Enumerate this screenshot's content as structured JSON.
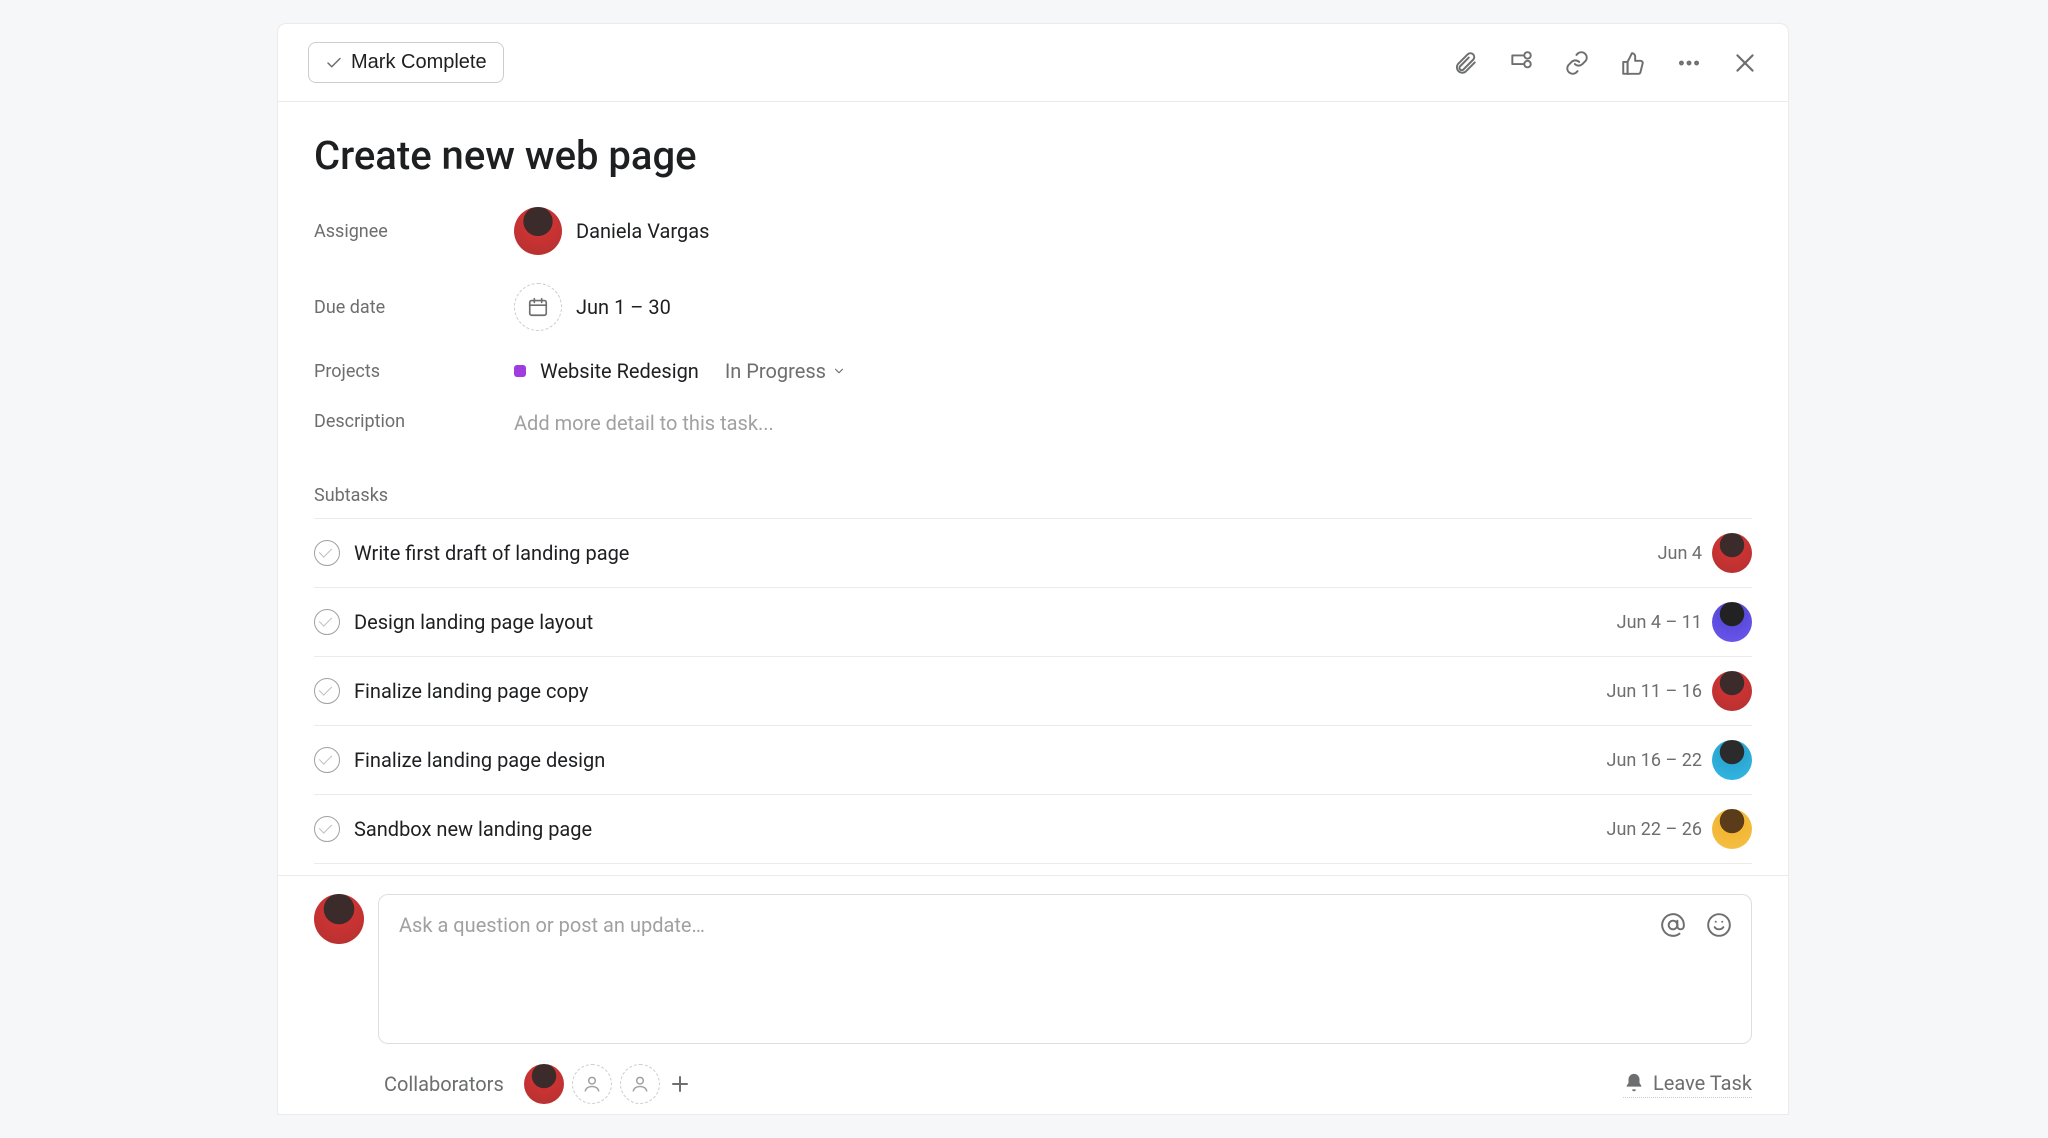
{
  "header": {
    "mark_complete": "Mark Complete"
  },
  "task": {
    "title": "Create new web page",
    "assignee_label": "Assignee",
    "assignee_name": "Daniela Vargas",
    "due_label": "Due date",
    "due_value": "Jun 1 – 30",
    "projects_label": "Projects",
    "project_name": "Website Redesign",
    "project_status": "In Progress",
    "description_label": "Description",
    "description_placeholder": "Add more detail to this task..."
  },
  "subtasks": {
    "label": "Subtasks",
    "items": [
      {
        "name": "Write first draft of landing page",
        "date": "Jun 4",
        "avatar": "a"
      },
      {
        "name": "Design landing page layout",
        "date": "Jun 4 – 11",
        "avatar": "b"
      },
      {
        "name": "Finalize landing page copy",
        "date": "Jun 11 – 16",
        "avatar": "a"
      },
      {
        "name": "Finalize landing page design",
        "date": "Jun 16 – 22",
        "avatar": "c"
      },
      {
        "name": "Sandbox new landing page",
        "date": "Jun 22 – 26",
        "avatar": "d"
      }
    ]
  },
  "composer": {
    "placeholder": "Ask a question or post an update…"
  },
  "collaborators": {
    "label": "Collaborators",
    "leave": "Leave Task"
  }
}
